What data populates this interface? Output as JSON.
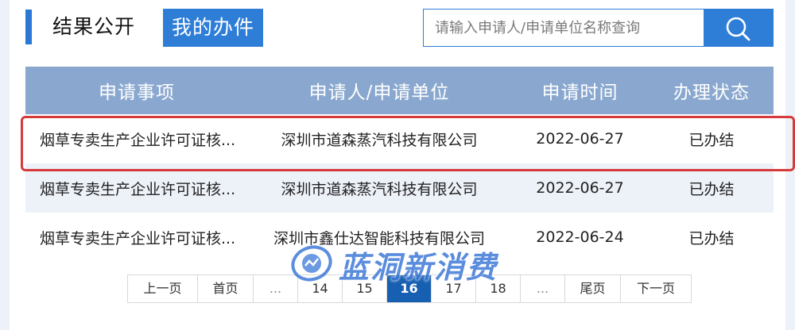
{
  "tabs": {
    "results_label": "结果公开",
    "mine_label": "我的办件"
  },
  "search": {
    "placeholder": "请输入申请人/申请单位名称查询",
    "icon": "search-icon"
  },
  "table": {
    "headers": [
      "申请事项",
      "申请人/申请单位",
      "申请时间",
      "办理状态"
    ],
    "rows": [
      {
        "item": "烟草专卖生产企业许可证核...",
        "applicant": "深圳市道森蒸汽科技有限公司",
        "date": "2022-06-27",
        "status": "已办结"
      },
      {
        "item": "烟草专卖生产企业许可证核...",
        "applicant": "深圳市道森蒸汽科技有限公司",
        "date": "2022-06-27",
        "status": "已办结"
      },
      {
        "item": "烟草专卖生产企业许可证核...",
        "applicant": "深圳市鑫仕达智能科技有限公司",
        "date": "2022-06-24",
        "status": "已办结"
      }
    ]
  },
  "pager": {
    "prev": "上一页",
    "first": "首页",
    "ellipsis": "...",
    "pages": [
      "14",
      "15",
      "16",
      "17",
      "18"
    ],
    "current": "16",
    "last": "尾页",
    "next": "下一页"
  },
  "watermark": {
    "text": "蓝洞新消费"
  },
  "colors": {
    "accent": "#2e7ed8",
    "header_bg": "#8aa8cf",
    "active_page": "#175fb0",
    "highlight_border": "#d63b3b"
  }
}
